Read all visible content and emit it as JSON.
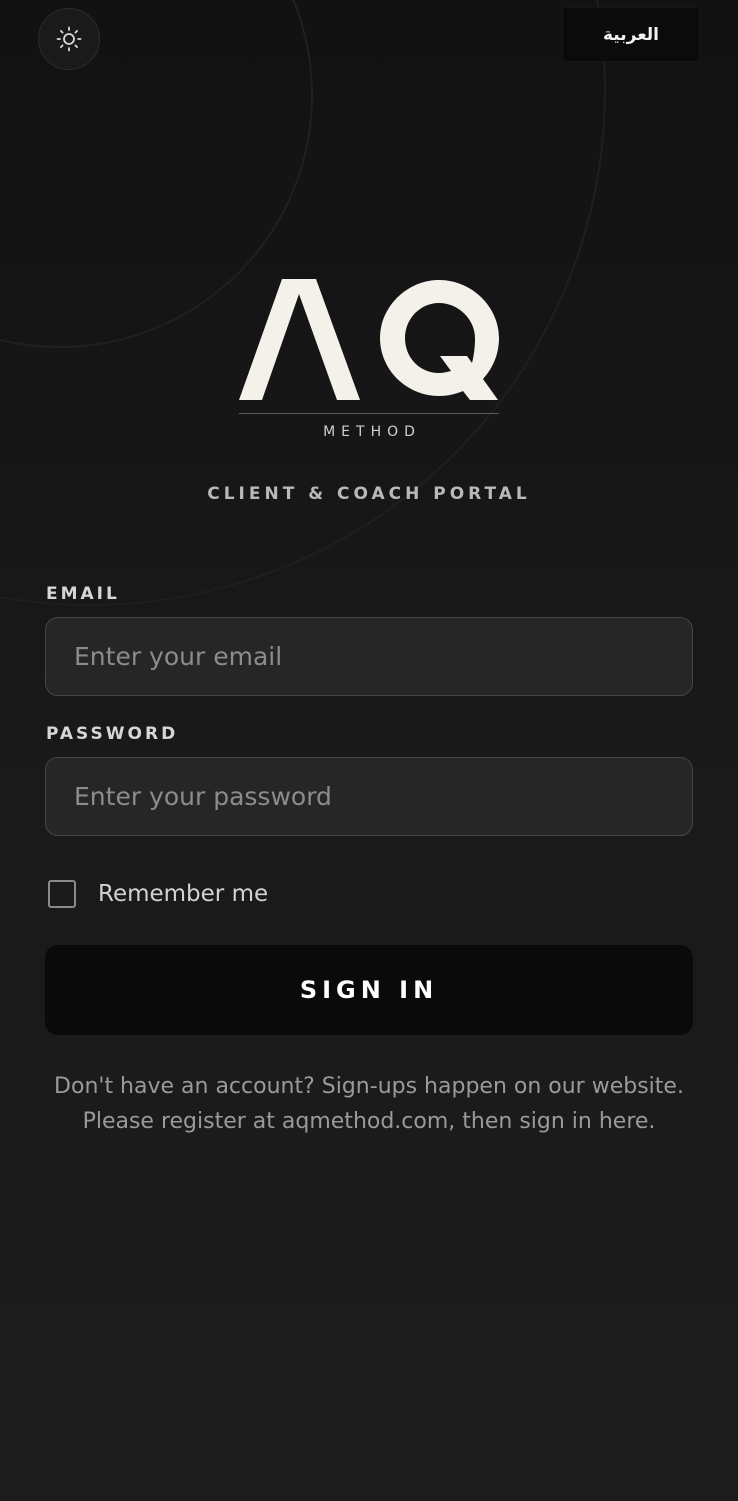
{
  "header": {
    "theme_icon": "sun-icon",
    "language_label": "العربية"
  },
  "brand": {
    "logo_text": "AQ",
    "logo_sub": "METHOD",
    "subtitle": "CLIENT & COACH PORTAL"
  },
  "form": {
    "email_label": "EMAIL",
    "email_placeholder": "Enter your email",
    "email_value": "",
    "password_label": "PASSWORD",
    "password_placeholder": "Enter your password",
    "password_value": "",
    "remember_label": "Remember me",
    "remember_checked": false,
    "submit_label": "SIGN IN"
  },
  "footer": {
    "signup_note": "Don't have an account? Sign-ups happen on our website. Please register at aqmethod.com, then sign in here."
  },
  "colors": {
    "background": "#141414",
    "input_background": "#262626",
    "button_background": "#0a0a0a",
    "logo": "#f4f1ea"
  }
}
